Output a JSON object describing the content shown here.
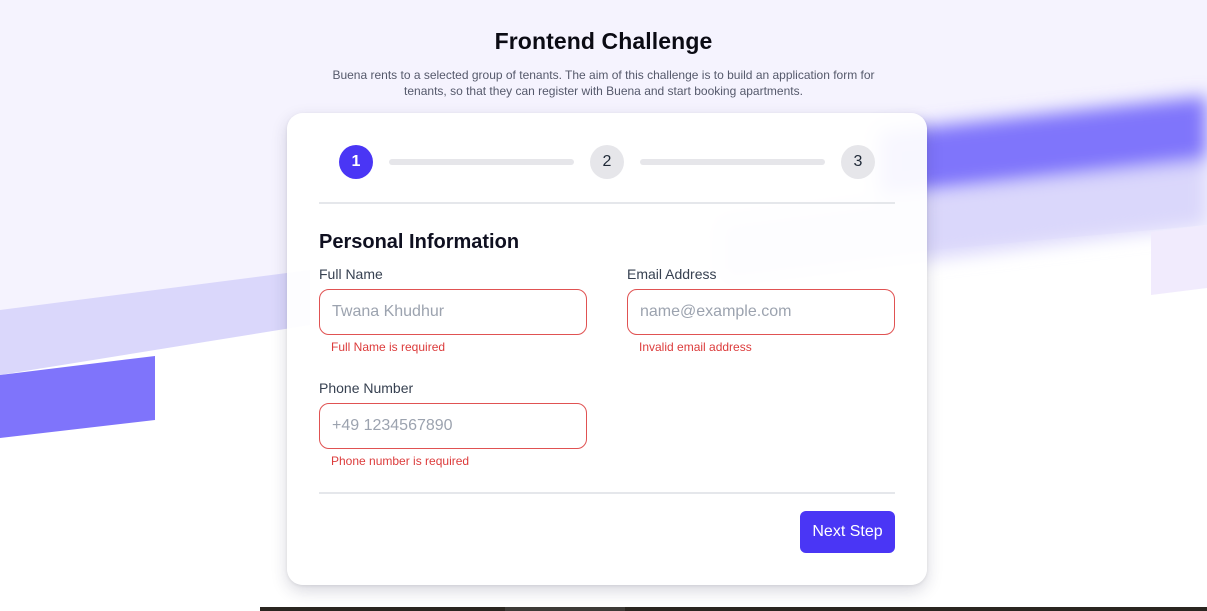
{
  "header": {
    "title": "Frontend Challenge",
    "subtitle": "Buena rents to a selected group of tenants. The aim of this challenge is to build an application form for tenants, so that they can register with Buena and start booking apartments."
  },
  "stepper": {
    "steps": [
      "1",
      "2",
      "3"
    ],
    "active_step": 1
  },
  "form": {
    "section_title": "Personal Information",
    "full_name": {
      "label": "Full Name",
      "placeholder": "Twana Khudhur",
      "value": "",
      "error": "Full Name is required"
    },
    "email": {
      "label": "Email Address",
      "placeholder": "name@example.com",
      "value": "",
      "error": "Invalid email address"
    },
    "phone": {
      "label": "Phone Number",
      "placeholder": "+49 1234567890",
      "value": "",
      "error": "Phone number is required"
    },
    "next_label": "Next Step"
  },
  "colors": {
    "accent": "#4a36f5",
    "error": "#dc3b3b",
    "band_dark": "#7f74fb",
    "band_light": "#dad7fb",
    "page_tint": "#f5f3fe"
  }
}
